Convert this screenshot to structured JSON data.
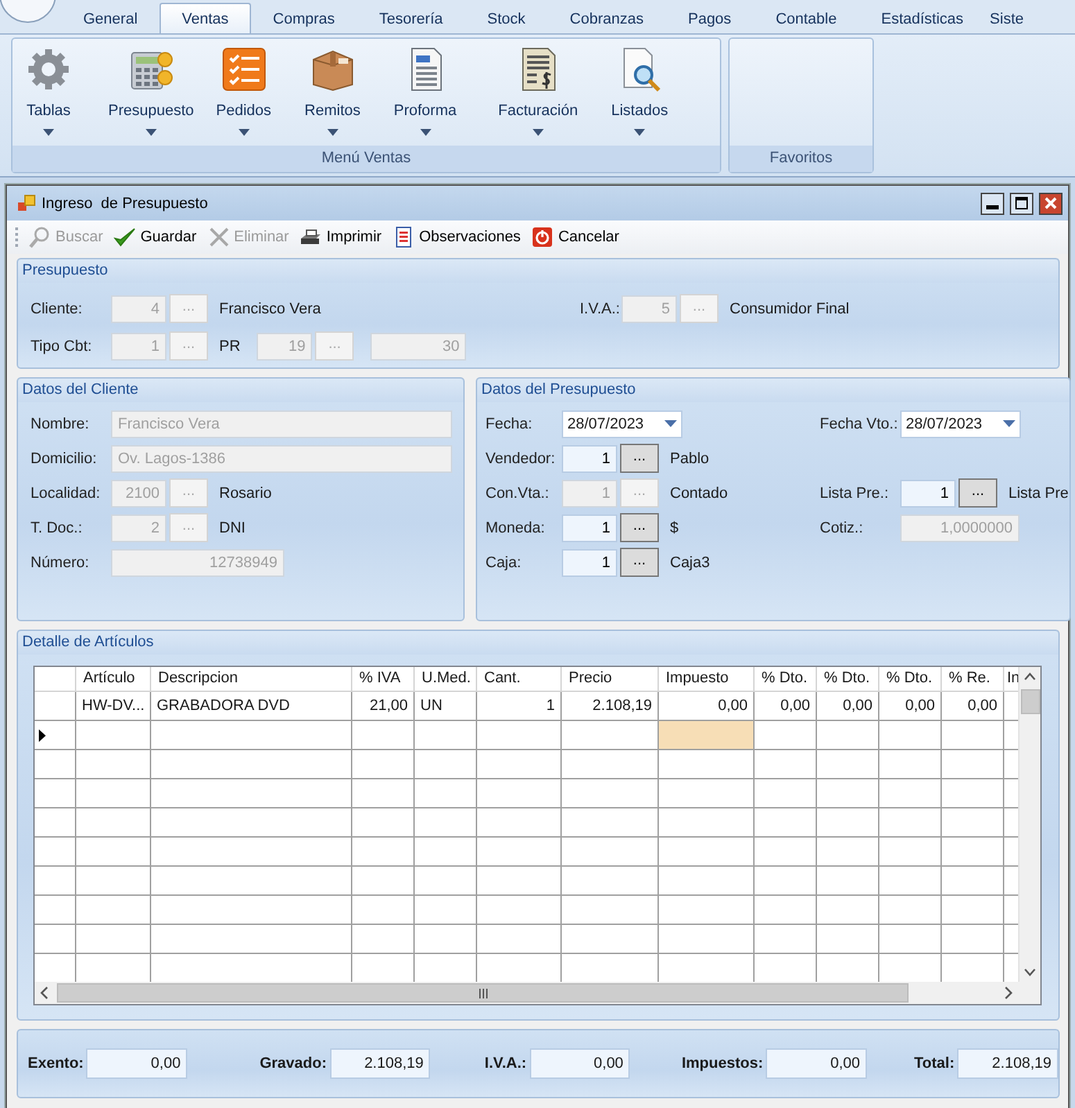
{
  "ribbon": {
    "tabs": [
      {
        "label": "General",
        "selected": false
      },
      {
        "label": "Ventas",
        "selected": true
      },
      {
        "label": "Compras",
        "selected": false
      },
      {
        "label": "Tesorería",
        "selected": false
      },
      {
        "label": "Stock",
        "selected": false
      },
      {
        "label": "Cobranzas",
        "selected": false
      },
      {
        "label": "Pagos",
        "selected": false
      },
      {
        "label": "Contable",
        "selected": false
      },
      {
        "label": "Estadísticas",
        "selected": false
      },
      {
        "label": "Siste",
        "selected": false
      }
    ],
    "groups": [
      {
        "title": "Menú Ventas",
        "buttons": [
          {
            "label": "Tablas",
            "kind": "gear"
          },
          {
            "label": "Presupuesto",
            "kind": "calculator"
          },
          {
            "label": "Pedidos",
            "kind": "checklist"
          },
          {
            "label": "Remitos",
            "kind": "box"
          },
          {
            "label": "Proforma",
            "kind": "document"
          },
          {
            "label": "Facturación",
            "kind": "invoice"
          },
          {
            "label": "Listados",
            "kind": "report"
          }
        ]
      },
      {
        "title": "Favoritos"
      }
    ]
  },
  "window": {
    "title": "Ingreso  de Presupuesto"
  },
  "toolbar": [
    {
      "label": "Buscar",
      "kind": "search",
      "disabled": true
    },
    {
      "label": "Guardar",
      "kind": "check",
      "disabled": false
    },
    {
      "label": "Eliminar",
      "kind": "cross",
      "disabled": true
    },
    {
      "label": "Imprimir",
      "kind": "printer",
      "disabled": false
    },
    {
      "label": "Observaciones",
      "kind": "notes",
      "disabled": false
    },
    {
      "label": "Cancelar",
      "kind": "cancel",
      "disabled": false
    }
  ],
  "presupuesto": {
    "title": "Presupuesto",
    "rows": [
      {
        "left": [
          {
            "label": "Cliente:",
            "kind": "code",
            "value": "4",
            "button": "...",
            "caption": "Francisco Vera",
            "disabled": true
          }
        ],
        "right": [
          {
            "label": "I.V.A.:",
            "kind": "code",
            "value": "5",
            "button": "...",
            "caption": "Consumidor Final",
            "disabled": true
          }
        ]
      },
      {
        "left": [
          {
            "label": "Tipo Cbt:",
            "kind": "code",
            "value": "1",
            "button": "...",
            "caption": "PR",
            "disabled": true
          },
          {
            "kind": "code",
            "value": "19",
            "button": "...",
            "disabled": true
          },
          {
            "kind": "number",
            "value": "30",
            "disabled": true
          }
        ]
      }
    ]
  },
  "cliente": {
    "title": "Datos del Cliente",
    "rows": [
      {
        "label": "Nombre:",
        "kind": "text",
        "value": "Francisco Vera",
        "disabled": true
      },
      {
        "label": "Domicilio:",
        "kind": "text",
        "value": "Ov. Lagos-1386",
        "disabled": true
      },
      {
        "label": "Localidad:",
        "kind": "code",
        "value": "2100",
        "button": "...",
        "caption": "Rosario",
        "disabled": true
      },
      {
        "label": "T. Doc.:",
        "kind": "code",
        "value": "2",
        "button": "...",
        "caption": "DNI",
        "disabled": true
      },
      {
        "label": "Número:",
        "kind": "number",
        "value": "12738949",
        "disabled": true
      }
    ]
  },
  "datos_presupuesto": {
    "title": "Datos del Presupuesto",
    "rows": [
      {
        "left": {
          "label": "Fecha:",
          "kind": "date",
          "value": "28/07/2023",
          "disabled": false
        },
        "right": {
          "label": "Fecha Vto.:",
          "kind": "date",
          "value": "28/07/2023",
          "disabled": false
        }
      },
      {
        "left": {
          "label": "Vendedor:",
          "kind": "code",
          "value": "1",
          "button": "...",
          "caption": "Pablo",
          "disabled": false
        }
      },
      {
        "left": {
          "label": "Con.Vta.:",
          "kind": "code",
          "value": "1",
          "button": "...",
          "caption": "Contado",
          "disabled": true
        },
        "right": {
          "label": "Lista Pre.:",
          "kind": "code",
          "value": "1",
          "button": "...",
          "caption": "Lista Pre",
          "disabled": false
        }
      },
      {
        "left": {
          "label": "Moneda:",
          "kind": "code",
          "value": "1",
          "button": "...",
          "caption": "$",
          "disabled": false
        },
        "right": {
          "label": "Cotiz.:",
          "kind": "number",
          "value": "1,0000000",
          "disabled": true
        }
      },
      {
        "left": {
          "label": "Caja:",
          "kind": "code",
          "value": "1",
          "button": "...",
          "caption": "Caja3",
          "disabled": false
        }
      }
    ]
  },
  "detalle": {
    "title": "Detalle de Artículos",
    "columns": [
      {
        "label": "Artículo",
        "current": false
      },
      {
        "label": "Descripcion",
        "current": false
      },
      {
        "label": "% IVA",
        "current": false
      },
      {
        "label": "U.Med.",
        "current": false
      },
      {
        "label": "Cant.",
        "current": false
      },
      {
        "label": "Precio",
        "current": false
      },
      {
        "label": "Impuesto",
        "current": true
      },
      {
        "label": "% Dto.",
        "current": false
      },
      {
        "label": "% Dto.",
        "current": false
      },
      {
        "label": "% Dto.",
        "current": false
      },
      {
        "label": "% Re.",
        "current": false
      },
      {
        "label": "In",
        "current": false
      }
    ],
    "rows": [
      {
        "cells": [
          "HW-DV...",
          "GRABADORA DVD",
          "21,00",
          "UN",
          "1",
          "2.108,19",
          "0,00",
          "0,00",
          "0,00",
          "0,00",
          "0,00"
        ]
      }
    ],
    "new_row": {
      "selected": true
    }
  },
  "totales": [
    {
      "label": "Exento:",
      "value": "0,00"
    },
    {
      "label": "Gravado:",
      "value": "2.108,19"
    },
    {
      "label": "I.V.A.:",
      "value": "0,00"
    },
    {
      "label": "Impuestos:",
      "value": "0,00"
    },
    {
      "label": "Total:",
      "value": "2.108,19"
    }
  ]
}
